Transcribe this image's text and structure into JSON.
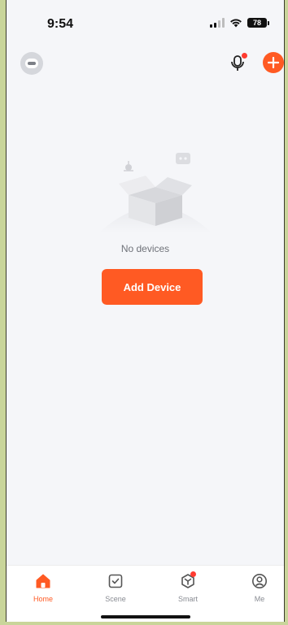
{
  "status_bar": {
    "time": "9:54",
    "battery": "78"
  },
  "empty_state": {
    "message": "No devices",
    "button_label": "Add Device"
  },
  "tabs": [
    {
      "label": "Home"
    },
    {
      "label": "Scene"
    },
    {
      "label": "Smart"
    },
    {
      "label": "Me"
    }
  ],
  "colors": {
    "accent": "#ff5a23",
    "badge": "#ff3b30",
    "background": "#f5f6f9",
    "inactive": "#888b92"
  },
  "icons": [
    "avatar-icon",
    "microphone-icon",
    "add-icon",
    "home-icon",
    "scene-icon",
    "smart-icon",
    "me-icon"
  ]
}
